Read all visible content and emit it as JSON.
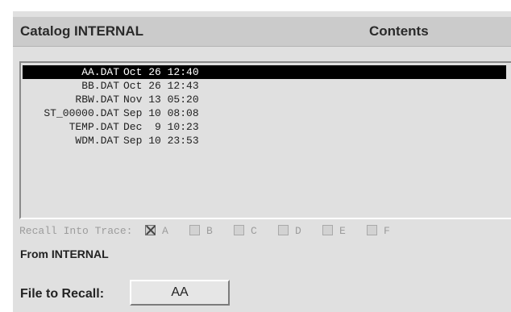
{
  "header": {
    "title": "Catalog INTERNAL",
    "contents_label": "Contents"
  },
  "files": [
    {
      "name": "AA.DAT",
      "date": "Oct 26 12:40",
      "selected": true
    },
    {
      "name": "BB.DAT",
      "date": "Oct 26 12:43",
      "selected": false
    },
    {
      "name": "RBW.DAT",
      "date": "Nov 13 05:20",
      "selected": false
    },
    {
      "name": "ST_00000.DAT",
      "date": "Sep 10 08:08",
      "selected": false
    },
    {
      "name": "TEMP.DAT",
      "date": "Dec  9 10:23",
      "selected": false
    },
    {
      "name": "WDM.DAT",
      "date": "Sep 10 23:53",
      "selected": false
    }
  ],
  "recall": {
    "label": "Recall Into Trace:",
    "options": [
      {
        "letter": "A",
        "checked": true
      },
      {
        "letter": "B",
        "checked": false
      },
      {
        "letter": "C",
        "checked": false
      },
      {
        "letter": "D",
        "checked": false
      },
      {
        "letter": "E",
        "checked": false
      },
      {
        "letter": "F",
        "checked": false
      }
    ]
  },
  "from_label": "From INTERNAL",
  "file_to_recall": {
    "label": "File to Recall:",
    "value": "AA"
  }
}
